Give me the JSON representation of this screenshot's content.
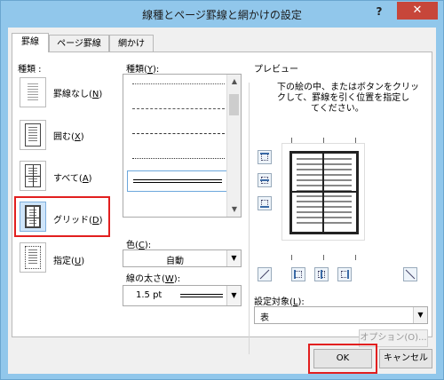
{
  "window": {
    "title": "線種とページ罫線と網かけの設定",
    "help_label": "?",
    "close_label": "✕"
  },
  "tabs": [
    {
      "label": "罫線",
      "active": true
    },
    {
      "label": "ページ罫線",
      "active": false
    },
    {
      "label": "網かけ",
      "active": false
    }
  ],
  "settings": {
    "heading": "種類 :",
    "items": [
      {
        "label": "罫線なし",
        "mnemonic": "N",
        "icon": "no-border-icon"
      },
      {
        "label": "囲む",
        "mnemonic": "X",
        "icon": "box-border-icon"
      },
      {
        "label": "すべて",
        "mnemonic": "A",
        "icon": "all-borders-icon"
      },
      {
        "label": "グリッド",
        "mnemonic": "D",
        "icon": "grid-border-icon",
        "selected": true
      },
      {
        "label": "指定",
        "mnemonic": "U",
        "icon": "custom-border-icon"
      }
    ]
  },
  "style": {
    "label": "種類",
    "mnemonic": "Y",
    "suffix": ":"
  },
  "color": {
    "label": "色",
    "mnemonic": "C",
    "suffix": ":",
    "value": "自動"
  },
  "width": {
    "label": "線の太さ",
    "mnemonic": "W",
    "suffix": ":",
    "value": "1.5 pt"
  },
  "preview": {
    "heading": "プレビュー",
    "instruction_line1": "下の絵の中、またはボタンをクリッ",
    "instruction_line2": "クして、罫線を引く位置を指定し",
    "instruction_line3": "てください。"
  },
  "apply_to": {
    "label": "設定対象",
    "mnemonic": "L",
    "suffix": ":",
    "value": "表"
  },
  "options_button": "オプション(O)...",
  "footer": {
    "ok": "OK",
    "cancel": "キャンセル"
  },
  "colors": {
    "title_bar": "#91c7eb",
    "close_button": "#c7463a",
    "highlight": "#e21f1f",
    "selected_row": "#cfe5fa"
  }
}
